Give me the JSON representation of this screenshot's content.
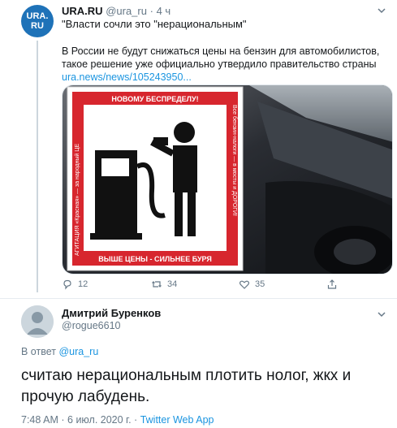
{
  "tweet": {
    "author_name": "URA.RU",
    "handle": "@ura_ru",
    "separator": "·",
    "time": "4 ч",
    "quote": "\"Власти сочли это \"нерациональным\"",
    "text": "В России не будут снижаться цены на бензин для автомобилистов, такое решение уже официально утвердило правительство страны",
    "link": "ura.news/news/105243950...",
    "avatar_text_line1": "URA.",
    "avatar_text_line2": "RU",
    "sticker": {
      "top_text": "НОВОМУ БЕСПРЕДЕЛУ!",
      "left_text": "АГИТАЦИЯ «Красная» — за народный ЦЕ",
      "right_text": "Все бензин-налоги — в мосты и ДОРОГИ!",
      "bottom_text": "ВЫШЕ ЦЕНЫ - СИЛЬНЕЕ БУРЯ"
    },
    "actions": {
      "replies": "12",
      "retweets": "34",
      "likes": "35"
    }
  },
  "reply": {
    "author_name": "Дмитрий Буренков",
    "handle": "@rogue6610",
    "reply_to_prefix": "В ответ",
    "reply_to_handle": "@ura_ru",
    "text": "считаю нерациональным плотить нолог, жкх  и прочую лабудень.",
    "time": "7:48 AM",
    "date": "6 июл. 2020 г.",
    "source": "Twitter Web App",
    "separator": "·"
  },
  "colors": {
    "accent": "#1b95e0",
    "muted": "#657786",
    "sticker_red": "#d7262e",
    "car_dark": "#1a1c20"
  }
}
